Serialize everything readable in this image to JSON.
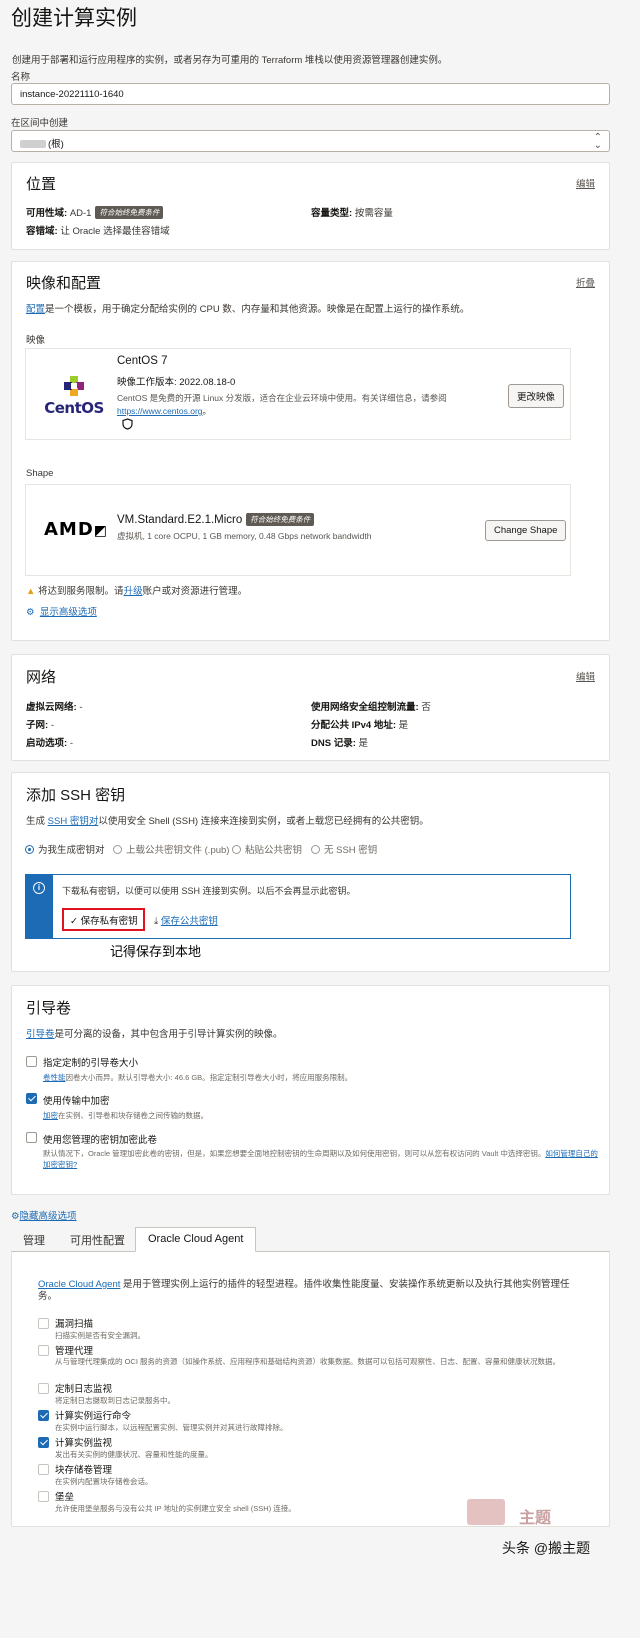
{
  "page": {
    "title": "创建计算实例",
    "description": "创建用于部署和运行应用程序的实例，或者另存为可重用的 Terraform 堆栈以使用资源管理器创建实例。",
    "name_label": "名称",
    "name_value": "instance-20221110-1640",
    "compartment_label": "在区间中创建",
    "compartment_value": "(根)"
  },
  "placement": {
    "title": "位置",
    "edit": "编辑",
    "ad_label": "可用性域:",
    "ad_value": "AD-1",
    "free_badge": "符合始终免费条件",
    "capacity_label": "容量类型:",
    "capacity_value": "按需容量",
    "fault_label": "容错域:",
    "fault_value": "让 Oracle 选择最佳容错域"
  },
  "image_shape": {
    "title": "映像和配置",
    "collapse": "折叠",
    "desc_link": "配置",
    "desc_rest": "是一个模板，用于确定分配给实例的 CPU 数、内存量和其他资源。映像是在配置上运行的操作系统。",
    "image_label": "映像",
    "image_logo_text": "CentOS",
    "image_name": "CentOS 7",
    "image_build": "映像工作版本: 2022.08.18-0",
    "image_desc": "CentOS 是免费的开源 Linux 分发版，适合在企业云环境中使用。有关详细信息，请参阅",
    "image_url": "https://www.centos.org",
    "image_url_suffix": "。",
    "change_image": "更改映像",
    "shape_label": "Shape",
    "shape_logo_text": "AMD",
    "shape_name": "VM.Standard.E2.1.Micro",
    "shape_badge": "符合始终免费条件",
    "shape_desc": "虚拟机, 1 core OCPU, 1 GB memory, 0.48 Gbps network bandwidth",
    "change_shape": "Change Shape",
    "warn_pre": "将达到服务限制。请",
    "warn_link": "升级",
    "warn_post": "账户或对资源进行管理。",
    "advanced": "显示高级选项"
  },
  "network": {
    "title": "网络",
    "edit": "编辑",
    "vcn_label": "虚拟云网络:",
    "vcn_value": "-",
    "subnet_label": "子网:",
    "subnet_value": "-",
    "launch_label": "启动选项:",
    "launch_value": "-",
    "nsg_label": "使用网络安全组控制流量:",
    "nsg_value": "否",
    "ipv4_label": "分配公共 IPv4 地址:",
    "ipv4_value": "是",
    "dns_label": "DNS 记录:",
    "dns_value": "是"
  },
  "ssh": {
    "title": "添加 SSH 密钥",
    "desc_pre": "生成 ",
    "desc_link": "SSH 密钥对",
    "desc_post": "以使用安全 Shell (SSH) 连接来连接到实例，或者上载您已经拥有的公共密钥。",
    "options": [
      "为我生成密钥对",
      "上载公共密钥文件 (.pub)",
      "粘贴公共密钥",
      "无 SSH 密钥"
    ],
    "info": "下载私有密钥，以便可以使用 SSH 连接到实例。以后不会再显示此密钥。",
    "save_private": "保存私有密钥",
    "save_public": "保存公共密钥",
    "annotation": "记得保存到本地"
  },
  "boot": {
    "title": "引导卷",
    "desc_link": "引导卷",
    "desc_rest": "是可分离的设备，其中包含用于引导计算实例的映像。",
    "items": [
      {
        "label": "指定定制的引导卷大小",
        "link": "卷性能",
        "desc": "因卷大小而异。默认引导卷大小: 46.6 GB。指定定制引导卷大小时，将应用服务限制。",
        "checked": false
      },
      {
        "label": "使用传输中加密",
        "link": "加密",
        "desc": "在实例、引导卷和块存储卷之间传输的数据。",
        "checked": true
      },
      {
        "label": "使用您管理的密钥加密此卷",
        "link": "",
        "desc": "默认情况下，Oracle 管理加密此卷的密钥，但是，如果您想要全面地控制密钥的生命周期以及如何使用密钥，则可以从您有权访问的 Vault 中选择密钥。",
        "desc_link": "如何管理自己的加密密钥?",
        "checked": false
      }
    ],
    "hide_advanced": "隐藏高级选项"
  },
  "tabs": [
    "管理",
    "可用性配置",
    "Oracle Cloud Agent"
  ],
  "agent": {
    "desc_link": "Oracle Cloud Agent",
    "desc_rest": " 是用于管理实例上运行的插件的轻型进程。插件收集性能度量、安装操作系统更新以及执行其他实例管理任务。",
    "plugins": [
      {
        "label": "漏洞扫描",
        "desc": "扫描实例是否有安全漏洞。",
        "checked": false
      },
      {
        "label": "管理代理",
        "desc": "从与管理代理集成的 OCI 服务的资源（如操作系统、应用程序和基础结构资源）收集数据。数据可以包括可观察性、日志、配置、容量和健康状况数据。",
        "checked": false
      },
      {
        "label": "定制日志监视",
        "desc": "将定制日志摄取到日志记录服务中。",
        "checked": false
      },
      {
        "label": "计算实例运行命令",
        "desc": "在实例中运行脚本，以远程配置实例、管理实例并对其进行故障排除。",
        "checked": true
      },
      {
        "label": "计算实例监视",
        "desc": "发出有关实例的健康状况、容量和性能的度量。",
        "checked": true
      },
      {
        "label": "块存储卷管理",
        "desc": "在实例内配置块存储卷会话。",
        "checked": false
      },
      {
        "label": "堡垒",
        "desc": "允许使用堡垒服务与没有公共 IP 地址的实例建立安全 shell (SSH) 连接。",
        "checked": false
      }
    ]
  },
  "watermark": {
    "text1": "主题",
    "credit": "头条 @搬主题"
  },
  "colors": {
    "accent": "#1d6bb5",
    "highlight": "#e0141e",
    "badge": "#5f5a54"
  }
}
